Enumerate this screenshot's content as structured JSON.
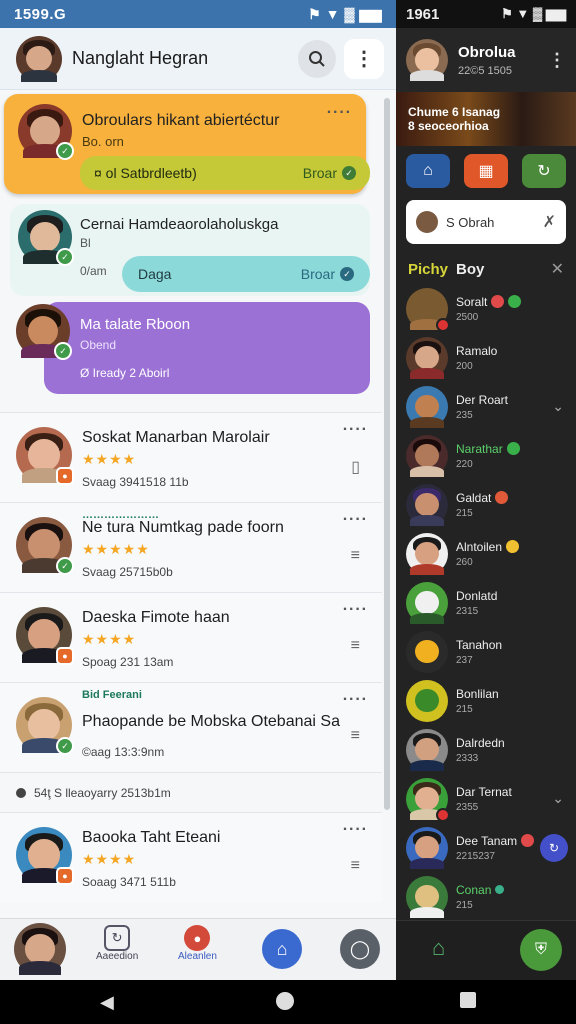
{
  "left_status": {
    "time": "1599.G",
    "icons": "⚑ ▼ ▓ ▆▆"
  },
  "left_header": {
    "title": "Nanglaht Hegran"
  },
  "cards": [
    {
      "name": "Obroulars hikant abiertéctur",
      "sub": "Bo. orn",
      "pill_left": "¤ ol Satbrdleetb)",
      "pill_right": "Broar"
    },
    {
      "name": "Cernai Hamdeaorolaholuskga",
      "sub": "Bl",
      "time": "0/am",
      "pill_left": "Daga",
      "pill_right": "Broar"
    },
    {
      "name": "Ma talate Rboon",
      "sub": "Obend",
      "time": "Ø Iready 2 Aboirl"
    }
  ],
  "rows": [
    {
      "tag": "",
      "name": "Soskat Manarban Marolair",
      "stars": "★★★★",
      "time": "Svaag 3941518 11b",
      "action": "▯"
    },
    {
      "tag": "…………………",
      "name": "Ne tura Numtkag pade foorn",
      "stars": "★★★★★",
      "time": "Svaag 25715b0b",
      "action": "≡"
    },
    {
      "tag": "",
      "name": "Daeska Fimote haan",
      "stars": "★★★★",
      "time": "Spoag 231 13am",
      "action": "≡"
    },
    {
      "tag": "Bid Feerani",
      "name": "Phaopande be Mobska Otebanai Sa",
      "stars": "",
      "time": "©aag 13:3:9nm",
      "action": "≡"
    }
  ],
  "separator": {
    "text": "54ţ S lleaoyarry 2513b1m"
  },
  "last_row": {
    "name": "Baooka Taht Eteani",
    "stars": "★★★★",
    "time": "Soaag 3471 511b",
    "action": "≡"
  },
  "bottom_nav_left": {
    "item1_label": "Aaeedion",
    "item2_label": "Aleanlen"
  },
  "right_status": {
    "time": "1961",
    "icons": "⚑ ▼ ▓ ▆▆"
  },
  "right_header": {
    "name": "Obrolua",
    "sub": "22©5 1505"
  },
  "banner": {
    "line1": "Chume 6 Isanag",
    "line2": "8 seoceorhioa"
  },
  "search": {
    "text": "S Obrah"
  },
  "section": {
    "title_a": "Pichy",
    "title_b": "Boy"
  },
  "contacts": [
    {
      "name": "Soralt",
      "sub": "2500"
    },
    {
      "name": "Ramalo",
      "sub": "200"
    },
    {
      "name": "Der Roart",
      "sub": "235"
    },
    {
      "name": "Narathar",
      "sub": "220"
    },
    {
      "name": "Galdat",
      "sub": "215"
    },
    {
      "name": "Alntoilen",
      "sub": "260"
    },
    {
      "name": "Donlatd",
      "sub": "2315"
    },
    {
      "name": "Tanahon",
      "sub": "237"
    },
    {
      "name": "Bonlilan",
      "sub": "215"
    },
    {
      "name": "Dalrdedn",
      "sub": "2333"
    },
    {
      "name": "Dar Ternat",
      "sub": "2355"
    },
    {
      "name": "Dee Tanam",
      "sub": "2215237"
    },
    {
      "name": "Conan",
      "sub": "215"
    }
  ]
}
